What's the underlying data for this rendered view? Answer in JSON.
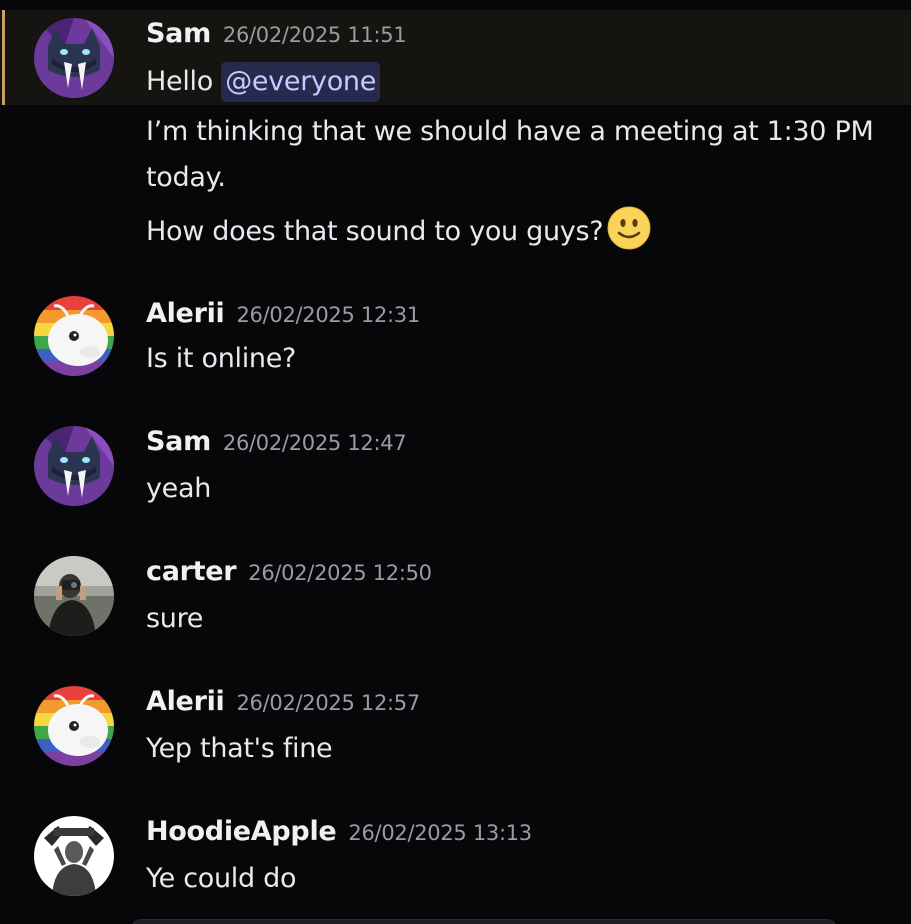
{
  "messages": [
    {
      "author": "Sam",
      "timestamp": "26/02/2025 11:51",
      "avatar": "purple-bat-creature-avatar",
      "lines": [
        {
          "text": "Hello ",
          "mention": "@everyone"
        },
        {
          "text": "I’m thinking that we should have a meeting at 1:30 PM"
        },
        {
          "text": "today."
        },
        {
          "text": "How does that sound to you guys?",
          "emoji": "slightly-smiling-face"
        }
      ],
      "highlighted": true
    },
    {
      "author": "Alerii",
      "timestamp": "26/02/2025 12:31",
      "avatar": "rainbow-white-creature-avatar",
      "lines": [
        {
          "text": "Is it online?"
        }
      ]
    },
    {
      "author": "Sam",
      "timestamp": "26/02/2025 12:47",
      "avatar": "purple-bat-creature-avatar",
      "lines": [
        {
          "text": "yeah"
        }
      ]
    },
    {
      "author": "carter",
      "timestamp": "26/02/2025 12:50",
      "avatar": "photo-person-camera-avatar",
      "lines": [
        {
          "text": "sure"
        }
      ]
    },
    {
      "author": "Alerii",
      "timestamp": "26/02/2025 12:57",
      "avatar": "rainbow-white-creature-avatar",
      "lines": [
        {
          "text": "Yep that's fine"
        }
      ]
    },
    {
      "author": "HoodieApple",
      "timestamp": "26/02/2025 13:13",
      "avatar": "photo-figure-black-white-avatar",
      "lines": [
        {
          "text": "Ye could do"
        }
      ]
    }
  ],
  "colors": {
    "background": "#070709",
    "highlight_bg": "#151410",
    "highlight_bar": "#c9a061",
    "mention_bg": "#262a4c",
    "mention_text": "#c4cbff",
    "timestamp": "#9a9ba4"
  }
}
